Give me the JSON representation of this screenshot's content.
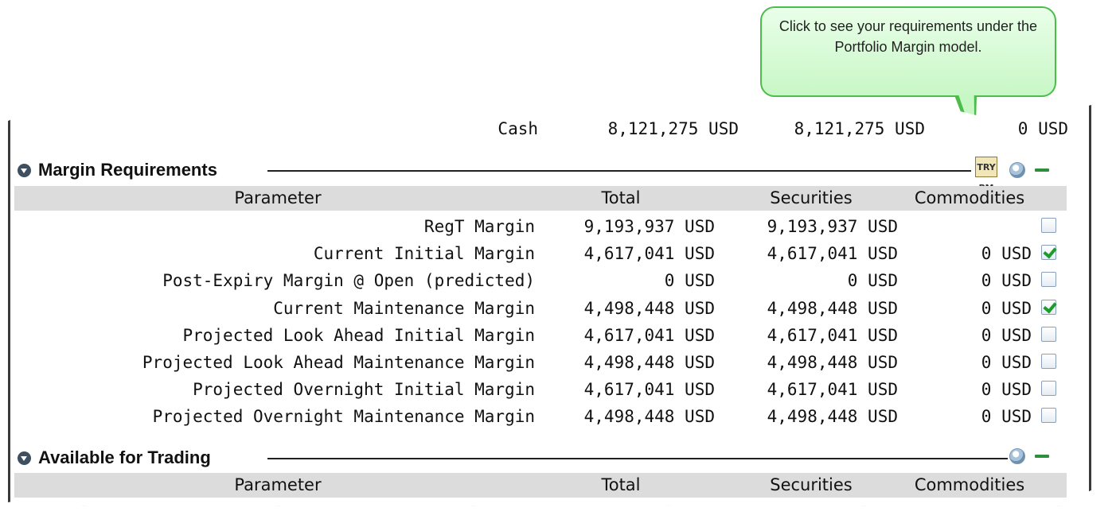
{
  "callout": {
    "text": "Click to see your requirements under the Portfolio Margin model."
  },
  "top_row": {
    "param": "Cash",
    "total": "8,121,275 USD",
    "securities": "8,121,275 USD",
    "commodities": "0 USD"
  },
  "margin_section": {
    "title": "Margin Requirements",
    "pm_icon": "TRY PM",
    "columns": [
      "Parameter",
      "Total",
      "Securities",
      "Commodities"
    ],
    "rows": [
      {
        "param": "RegT Margin",
        "total": "9,193,937 USD",
        "securities": "9,193,937 USD",
        "commodities": "",
        "checked": false
      },
      {
        "param": "Current Initial Margin",
        "total": "4,617,041 USD",
        "securities": "4,617,041 USD",
        "commodities": "0 USD",
        "checked": true
      },
      {
        "param": "Post-Expiry Margin @ Open (predicted)",
        "total": "0 USD",
        "securities": "0 USD",
        "commodities": "0 USD",
        "checked": false
      },
      {
        "param": "Current Maintenance Margin",
        "total": "4,498,448 USD",
        "securities": "4,498,448 USD",
        "commodities": "0 USD",
        "checked": true
      },
      {
        "param": "Projected Look Ahead Initial Margin",
        "total": "4,617,041 USD",
        "securities": "4,617,041 USD",
        "commodities": "0 USD",
        "checked": false
      },
      {
        "param": "Projected Look Ahead Maintenance Margin",
        "total": "4,498,448 USD",
        "securities": "4,498,448 USD",
        "commodities": "0 USD",
        "checked": false
      },
      {
        "param": "Projected Overnight Initial Margin",
        "total": "4,617,041 USD",
        "securities": "4,617,041 USD",
        "commodities": "0 USD",
        "checked": false
      },
      {
        "param": "Projected Overnight Maintenance Margin",
        "total": "4,498,448 USD",
        "securities": "4,498,448 USD",
        "commodities": "0 USD",
        "checked": false
      }
    ]
  },
  "trading_section": {
    "title": "Available for Trading",
    "columns": [
      "Parameter",
      "Total",
      "Securities",
      "Commodities"
    ]
  },
  "icons": {
    "section_toggle": "collapse-arrow-icon",
    "help": "help-icon",
    "minimize": "minimize-icon"
  },
  "colors": {
    "header_bg": "#dcdcdc",
    "callout_bg": "#c8f7c6",
    "callout_border": "#4cbc4a",
    "check": "#1e9b2a"
  }
}
